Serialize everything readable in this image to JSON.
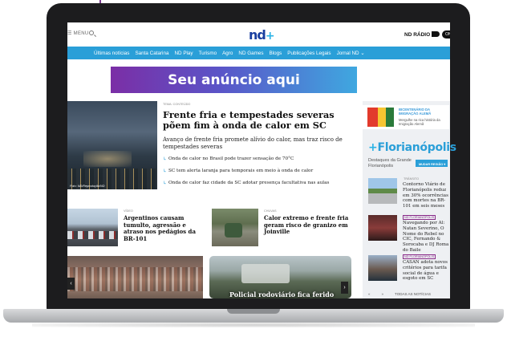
{
  "header": {
    "menu_label": "MENU",
    "logo_text": "nd",
    "logo_plus": "+",
    "radio_label": "ND RÁDIO",
    "live_label": "ON"
  },
  "nav": {
    "items": [
      "Últimas notícias",
      "Santa Catarina",
      "ND Play",
      "Turismo",
      "Agro",
      "ND Games",
      "Blogs",
      "Publicações Legais",
      "Jornal ND ⌄"
    ]
  },
  "ad": {
    "text": "Seu anúncio aqui"
  },
  "hero": {
    "kicker": "TEMA: CONTEÚDO",
    "title": "Frente fria e tempestades severas põem fim à onda de calor em SC",
    "subtitle": "Avanço de frente fria promete alívio do calor, mas traz risco de tempestades severas",
    "credit": "Foto: ND/Reprodução/ND",
    "related": [
      "Onda de calor no Brasil pode trazer sensação de 70°C",
      "SC tem alerta laranja para temporais em meio à onda de calor",
      "Onda de calor faz cidade da SC adotar presença facultativa nas aulas"
    ]
  },
  "stories": [
    {
      "kicker": "VÍDEO",
      "title": "Argentinos causam tumulto, agressão e atraso nos pedágios da BR-101"
    },
    {
      "kicker": "CHUVAS",
      "title": "Calor extremo e frente fria geram risco de granizo em Joinville"
    }
  ],
  "bottom": {
    "accident_title": "Policial rodoviário fica ferido",
    "prev": "‹",
    "next": "›"
  },
  "sidebar": {
    "mini_ad_title": "BICENTENÁRIO DA IMIGRAÇÃO ALEMÃ",
    "mini_ad_sub": "Mergulhe na rica história da Imigração Alemã",
    "city_plus": "+",
    "city": "Florianópolis",
    "destaques": "Destaques da Grande Florianópolis",
    "region_button": "MUDAR REGIÃO ▾",
    "items": [
      {
        "tag": "TRÂNSITO",
        "text": "Contorno Viário de Florianópolis reduz em 30% ocorrências com mortes na BR-101 em seis meses"
      },
      {
        "tag": "ND FLORIANÓPOLIS",
        "text": "Navegando por Al: Natan Severino, O Nome do Rebel no CIC, Fernando & Sorocaba e DJ Roma do Baile"
      },
      {
        "tag": "ND FLORIANÓPOLIS",
        "text": "CASAN adota novos critérios para tarifa social de água e esgoto em SC"
      }
    ],
    "footer_prev": "«",
    "footer_next": "»",
    "footer_all": "TODAS AS NOTÍCIAS"
  }
}
